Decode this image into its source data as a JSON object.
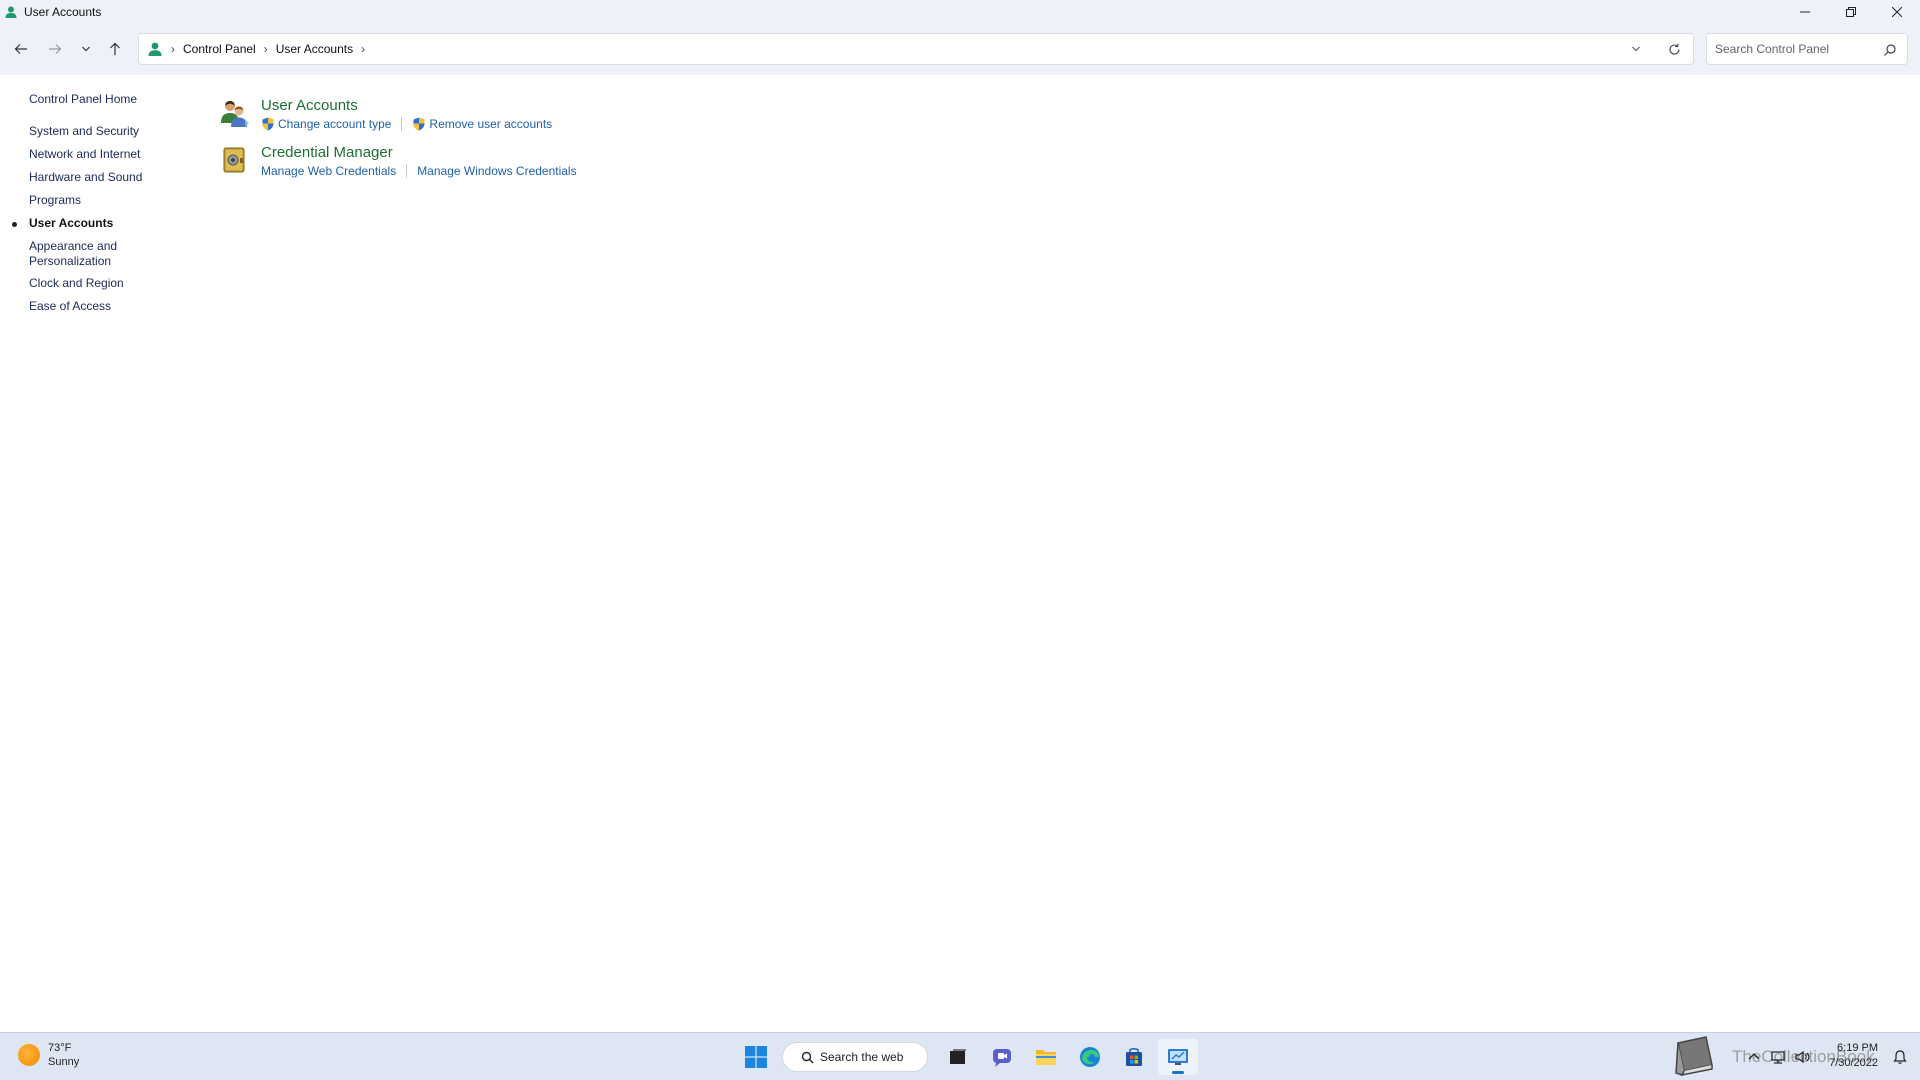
{
  "window": {
    "title": "User Accounts"
  },
  "address": {
    "crumbs": [
      "Control Panel",
      "User Accounts"
    ],
    "search_placeholder": "Search Control Panel"
  },
  "sidebar": {
    "home": "Control Panel Home",
    "categories": [
      {
        "label": "System and Security",
        "active": false
      },
      {
        "label": "Network and Internet",
        "active": false
      },
      {
        "label": "Hardware and Sound",
        "active": false
      },
      {
        "label": "Programs",
        "active": false
      },
      {
        "label": "User Accounts",
        "active": true
      },
      {
        "label": "Appearance and Personalization",
        "active": false
      },
      {
        "label": "Clock and Region",
        "active": false
      },
      {
        "label": "Ease of Access",
        "active": false
      }
    ]
  },
  "main": {
    "groups": [
      {
        "title": "User Accounts",
        "icon": "users-icon",
        "links": [
          {
            "label": "Change account type",
            "shield": true
          },
          {
            "label": "Remove user accounts",
            "shield": true
          }
        ]
      },
      {
        "title": "Credential Manager",
        "icon": "credential-vault-icon",
        "links": [
          {
            "label": "Manage Web Credentials",
            "shield": false
          },
          {
            "label": "Manage Windows Credentials",
            "shield": false
          }
        ]
      }
    ]
  },
  "taskbar": {
    "weather": {
      "temp": "73°F",
      "condition": "Sunny"
    },
    "search_label": "Search the web",
    "watermark": "TheCollectionBook",
    "time": "6:19 PM",
    "date": "7/30/2022"
  },
  "colors": {
    "accent": "#1a73c7",
    "group_title": "#1e6f2e",
    "link": "#1f5fb0",
    "chrome": "#eef2f8",
    "taskbar": "#dde6f2"
  }
}
